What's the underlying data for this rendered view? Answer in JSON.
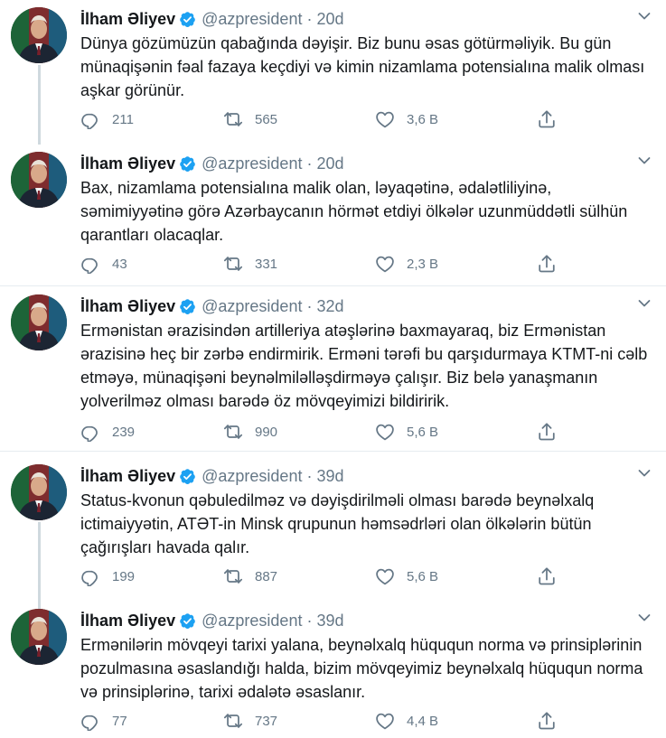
{
  "colors": {
    "verified": "#1da1f2",
    "muted": "#657786",
    "text": "#14171a",
    "divider": "#e6ecf0"
  },
  "icons": [
    "reply-icon",
    "retweet-icon",
    "like-icon",
    "share-icon",
    "verified-badge-icon",
    "chevron-down-icon"
  ],
  "tweets": [
    {
      "name": "İlham Əliyev",
      "handle": "@azpresident",
      "dot": "·",
      "time": "20d",
      "text": "Dünya gözümüzün qabağında dəyişir. Biz bunu əsas götürməliyik. Bu gün münaqişənin fəal fazaya keçdiyi və kimin nizamlama potensialına malik olması aşkar görünür.",
      "replies": "211",
      "retweets": "565",
      "likes": "3,6 B"
    },
    {
      "name": "İlham Əliyev",
      "handle": "@azpresident",
      "dot": "·",
      "time": "20d",
      "text": "Bax, nizamlama potensialına malik olan, ləyaqətinə, ədalətliliyinə, səmimiyyətinə görə Azərbaycanın hörmət etdiyi ölkələr uzunmüddətli sülhün qarantları olacaqlar.",
      "replies": "43",
      "retweets": "331",
      "likes": "2,3 B"
    },
    {
      "name": "İlham Əliyev",
      "handle": "@azpresident",
      "dot": "·",
      "time": "32d",
      "text": "Ermənistan ərazisindən artilleriya atəşlərinə baxmayaraq, biz Ermənistan ərazisinə heç bir zərbə endirmirik. Erməni tərəfi bu qarşıdurmaya KTMT-ni cəlb etməyə, münaqişəni beynəlmiləlləşdirməyə çalışır. Biz belə yanaşmanın yolverilməz olması barədə öz mövqeyimizi bildiririk.",
      "replies": "239",
      "retweets": "990",
      "likes": "5,6 B"
    },
    {
      "name": "İlham Əliyev",
      "handle": "@azpresident",
      "dot": "·",
      "time": "39d",
      "text": "Status-kvonun qəbuledilməz və dəyişdirilməli olması barədə beynəlxalq ictimaiyyətin, ATƏT-in Minsk qrupunun həmsədrləri olan ölkələrin bütün çağırışları havada qalır.",
      "replies": "199",
      "retweets": "887",
      "likes": "5,6 B"
    },
    {
      "name": "İlham Əliyev",
      "handle": "@azpresident",
      "dot": "·",
      "time": "39d",
      "text": "Ermənilərin mövqeyi tarixi yalana, beynəlxalq hüququn norma və prinsiplərinin pozulmasına əsaslandığı halda, bizim mövqeyimiz beynəlxalq hüququn norma və prinsiplərinə, tarixi ədalətə əsaslanır.",
      "replies": "77",
      "retweets": "737",
      "likes": "4,4 B"
    }
  ]
}
